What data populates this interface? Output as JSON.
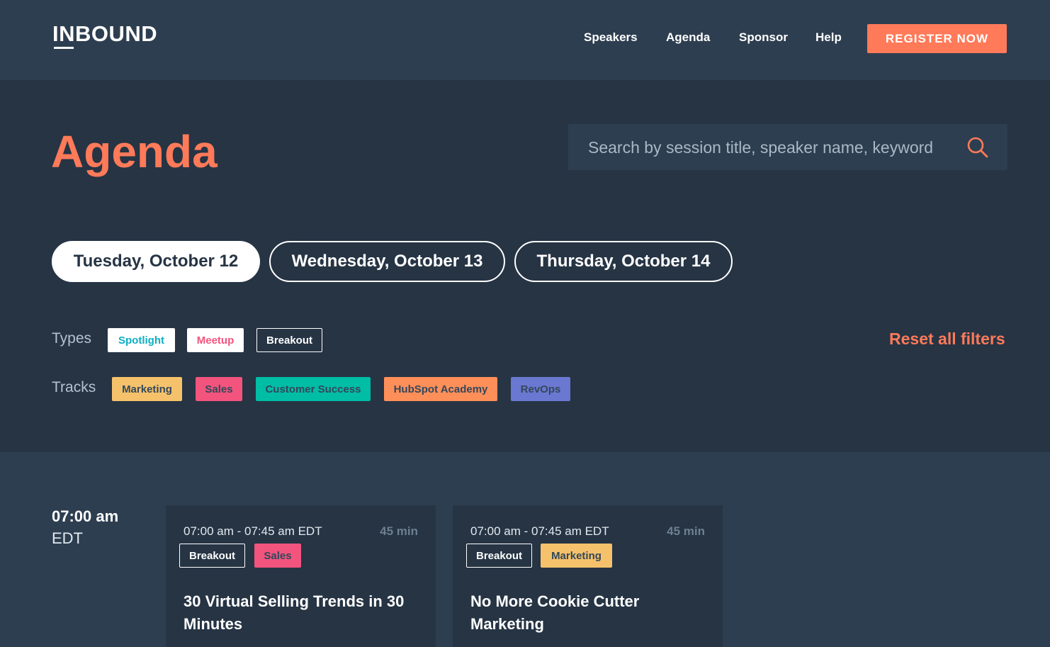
{
  "header": {
    "logo": "INBOUND",
    "nav": [
      "Speakers",
      "Agenda",
      "Sponsor",
      "Help"
    ],
    "register_label": "REGISTER NOW"
  },
  "hero": {
    "title": "Agenda",
    "search_placeholder": "Search by session title, speaker name, keyword",
    "days": [
      {
        "label": "Tuesday, October 12",
        "active": true
      },
      {
        "label": "Wednesday, October 13",
        "active": false
      },
      {
        "label": "Thursday, October 14",
        "active": false
      }
    ],
    "types_label": "Types",
    "types": [
      "Spotlight",
      "Meetup",
      "Breakout"
    ],
    "tracks_label": "Tracks",
    "tracks": [
      "Marketing",
      "Sales",
      "Customer Success",
      "HubSpot Academy",
      "RevOps"
    ],
    "reset_label": "Reset all filters"
  },
  "colors": {
    "accent": "#ff7a59",
    "spotlight": "#0bafc2",
    "meetup": "#f2547d",
    "marketing": "#f5c26b",
    "sales": "#f2547d",
    "customer_success": "#00bda5",
    "hubspot_academy": "#ff8f59",
    "revops": "#6a78d1"
  },
  "sessions": {
    "time": "07:00 am",
    "zone": "EDT",
    "cards": [
      {
        "time_range": "07:00 am - 07:45 am EDT",
        "duration": "45 min",
        "tags": [
          "Breakout",
          "Sales"
        ],
        "title": "30 Virtual Selling Trends in 30 Minutes"
      },
      {
        "time_range": "07:00 am - 07:45 am EDT",
        "duration": "45 min",
        "tags": [
          "Breakout",
          "Marketing"
        ],
        "title": "No More Cookie Cutter Marketing"
      }
    ]
  }
}
